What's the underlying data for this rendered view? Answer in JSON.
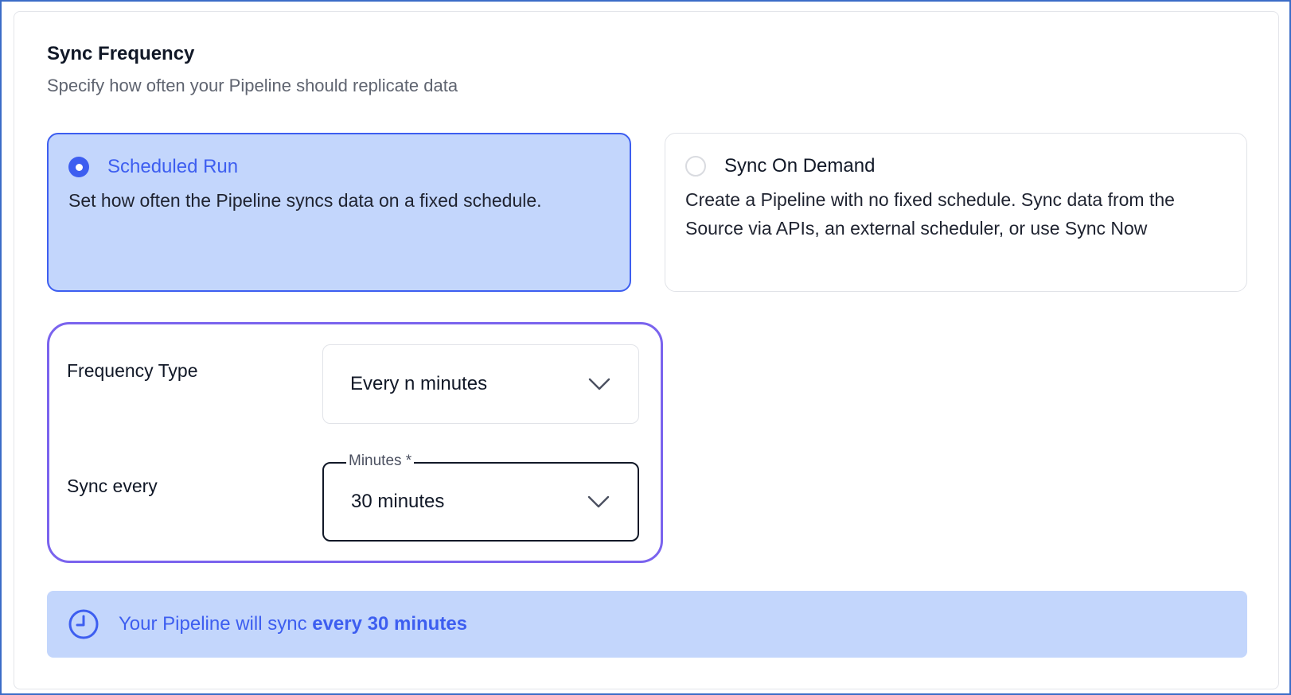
{
  "section": {
    "title": "Sync Frequency",
    "subtitle": "Specify how often your Pipeline should replicate data"
  },
  "options": {
    "scheduled": {
      "label": "Scheduled Run",
      "description": "Set how often the Pipeline syncs data on a fixed schedule.",
      "selected": true
    },
    "on_demand": {
      "label": "Sync On Demand",
      "description": "Create a Pipeline with no fixed schedule. Sync data from the Source via APIs, an external scheduler, or use Sync Now",
      "selected": false
    }
  },
  "frequency": {
    "type_label": "Frequency Type",
    "type_value": "Every n minutes",
    "sync_label": "Sync every",
    "minutes_label": "Minutes *",
    "minutes_value": "30 minutes"
  },
  "info": {
    "prefix": "Your Pipeline will sync ",
    "emphasis": "every 30 minutes",
    "icon": "clock-icon"
  },
  "colors": {
    "accent": "#3d5ef0",
    "selected_bg": "#c3d6fc",
    "focus_outline": "#7a63ee"
  }
}
